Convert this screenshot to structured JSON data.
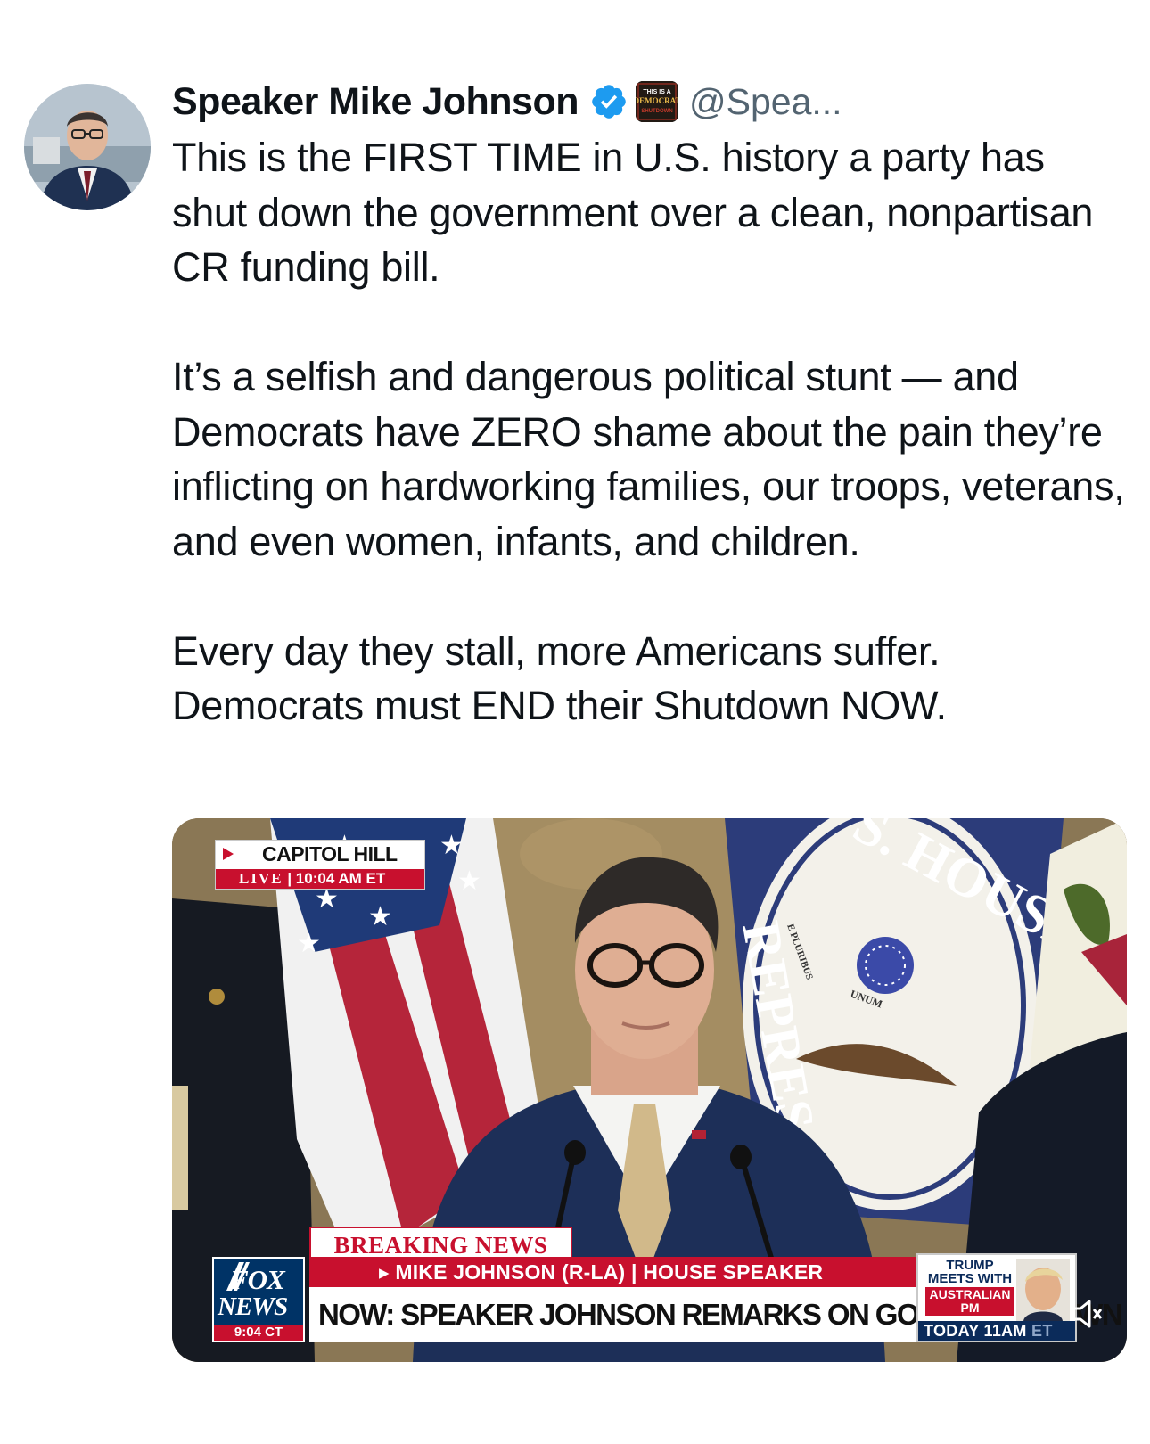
{
  "tweet": {
    "author_name": "Speaker Mike Johnson",
    "handle": "@Spea...",
    "text": "This is the FIRST TIME in U.S. history a party has shut down the government over a clean, nonpartisan CR funding bill.\n\nIt’s a selfish and dangerous political stunt — and Democrats have ZERO shame about the pain they’re inflicting on hardworking families, our troops, veterans, and even women, infants, and children.\n\nEvery day they stall, more Americans suffer. Democrats must END their Shutdown NOW."
  },
  "affiliation_badge": {
    "line1": "THIS IS A",
    "line2": "DEMOCRAT",
    "line3": "SHUTDOWN"
  },
  "video": {
    "location": "CAPITOL HILL",
    "live_label": "LIVE",
    "live_time": "10:04 AM ET",
    "breaking_label": "BREAKING NEWS",
    "lower_third_sub": "▸ MIKE JOHNSON (R-LA)  | HOUSE SPEAKER",
    "lower_third_main": "NOW: SPEAKER JOHNSON REMARKS ON GOVT SHUTDOWN",
    "network_line1": "FOX",
    "network_line2": "NEWS",
    "network_time": "9:04 CT",
    "promo_title": "TRUMP MEETS WITH",
    "promo_sub": "AUSTRALIAN PM",
    "promo_when": "TODAY 11AM",
    "promo_tz": "ET",
    "seal_text_1": "REPRES",
    "seal_text_2": "S. HOUSE OF",
    "seal_text_3": "E PLURIBUS",
    "seal_text_4": "UNUM"
  },
  "icons": {
    "verified": "verified-badge-icon",
    "mute": "mute-icon"
  },
  "colors": {
    "verified_blue": "#1d9bf0",
    "fox_red": "#c8102e",
    "fox_navy": "#003366",
    "handle_gray": "#536471"
  }
}
